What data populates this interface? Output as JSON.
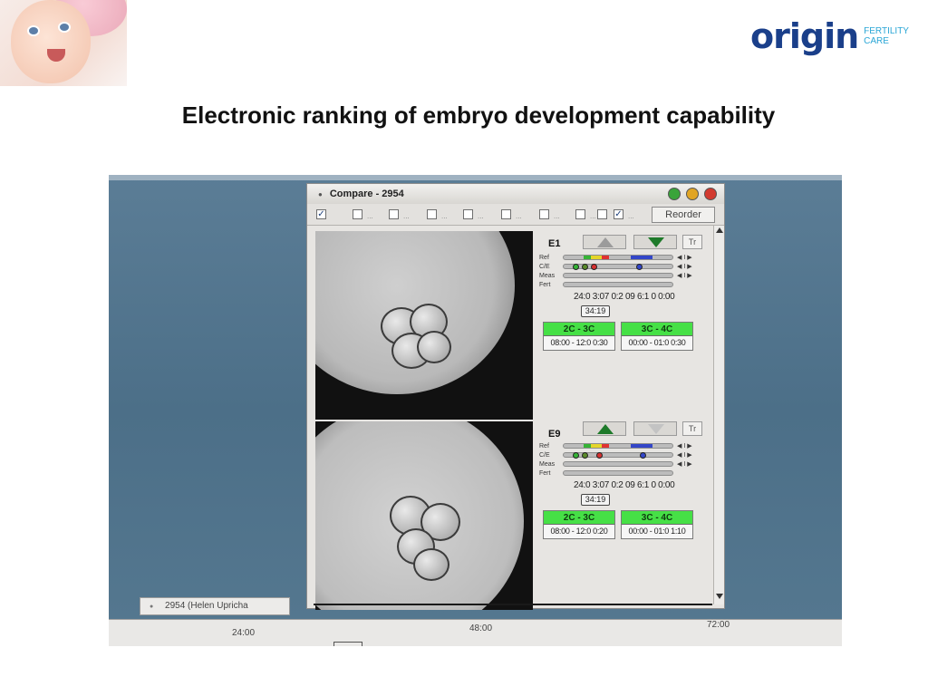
{
  "logo": {
    "word": "origin",
    "sub_line1": "FERTILITY",
    "sub_line2": "CARE"
  },
  "slide_title": "Electronic ranking of embryo development capability",
  "window": {
    "title": "Compare - 2954",
    "reorder_label": "Reorder"
  },
  "embryos": [
    {
      "name": "E1",
      "tr_label": "Tr",
      "rows": [
        "Ref",
        "C/E",
        "Meas",
        "Fert"
      ],
      "ctrl_symbol": "◀ I ▶",
      "times": "24:0 3:07 0:2 09 6:1 0 0:00",
      "readout": "34:19",
      "stages": [
        {
          "label": "2C - 3C",
          "range": "08:00 - 12:0 0:30"
        },
        {
          "label": "3C - 4C",
          "range": "00:00 - 01:0 0:30"
        }
      ]
    },
    {
      "name": "E9",
      "tr_label": "Tr",
      "rows": [
        "Ref",
        "C/E",
        "Meas",
        "Fert"
      ],
      "ctrl_symbol": "◀ I ▶",
      "times": "24:0 3:07 0:2 09 6:1 0 0:00",
      "readout": "34:19",
      "stages": [
        {
          "label": "2C - 3C",
          "range": "08:00 - 12:0 0:20"
        },
        {
          "label": "3C - 4C",
          "range": "00:00 - 01:0 1:10"
        }
      ]
    }
  ],
  "bottom_tab": "2954 (Helen Upricha",
  "timeline": {
    "ticks": [
      "24:00",
      "48:00",
      "72:00"
    ]
  },
  "colors": {
    "stage_green": "#46e046",
    "arrow_green": "#1e7a2a",
    "logo_blue": "#1a3f8a",
    "logo_cyan": "#2aa6d6"
  }
}
